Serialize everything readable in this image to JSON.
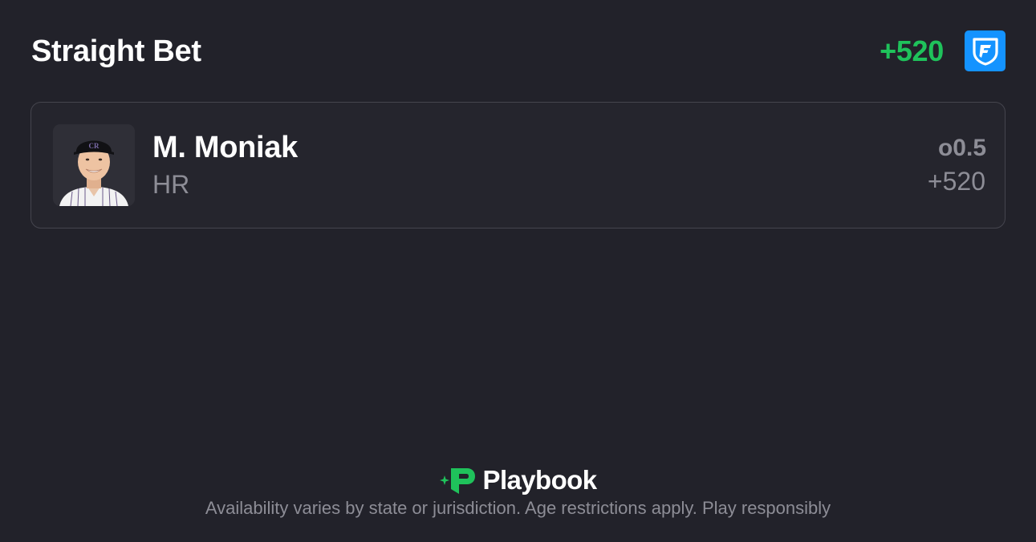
{
  "header": {
    "title": "Straight Bet",
    "total_odds": "+520",
    "sportsbook_icon": "fanduel-shield-icon",
    "sportsbook_color": "#1493ff"
  },
  "leg": {
    "player_name": "M. Moniak",
    "market": "HR",
    "line": "o0.5",
    "odds": "+520",
    "avatar_icon": "player-headshot"
  },
  "footer": {
    "brand_name": "Playbook",
    "brand_icon": "playbook-logo-icon",
    "brand_color": "#1fc25b",
    "disclaimer": "Availability varies by state or jurisdiction. Age restrictions apply. Play responsibly"
  },
  "colors": {
    "background": "#22222a",
    "card_background": "#25252d",
    "odds_positive": "#1fc25b",
    "muted_text": "#8d8d96"
  }
}
